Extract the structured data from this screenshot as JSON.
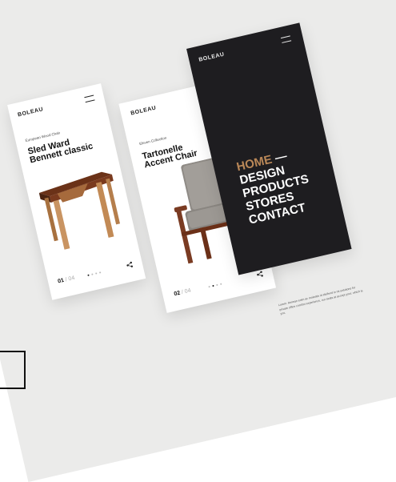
{
  "phone1": {
    "logo": "BOLEAU",
    "category": "European Wood Chair",
    "title_line1": "Sled Ward",
    "title_line2": "Bennett classic",
    "page_current": "01",
    "page_total": "/ 04"
  },
  "phone2": {
    "logo": "BOLEAU",
    "category": "Eleven Collection",
    "title_line1": "Tartonelle",
    "title_line2": "Accent Chair",
    "page_current": "02",
    "page_total": "/ 04"
  },
  "phone3": {
    "logo": "BOLEAU",
    "menu": [
      {
        "label": "HOME",
        "active": true
      },
      {
        "label": "DESIGN",
        "active": false
      },
      {
        "label": "PRODUCTS",
        "active": false
      },
      {
        "label": "STORES",
        "active": false
      },
      {
        "label": "CONTACT",
        "active": false
      }
    ]
  },
  "description": "Lorem. Aenean enim ac molestie id eleifend in mi solutions for private office comfort experience, our seats at accept your, which is you.",
  "colors": {
    "background": "#ebebea",
    "dark_panel": "#1e1d20",
    "accent": "#b98757"
  },
  "icons": [
    "menu-icon",
    "share-icon"
  ]
}
